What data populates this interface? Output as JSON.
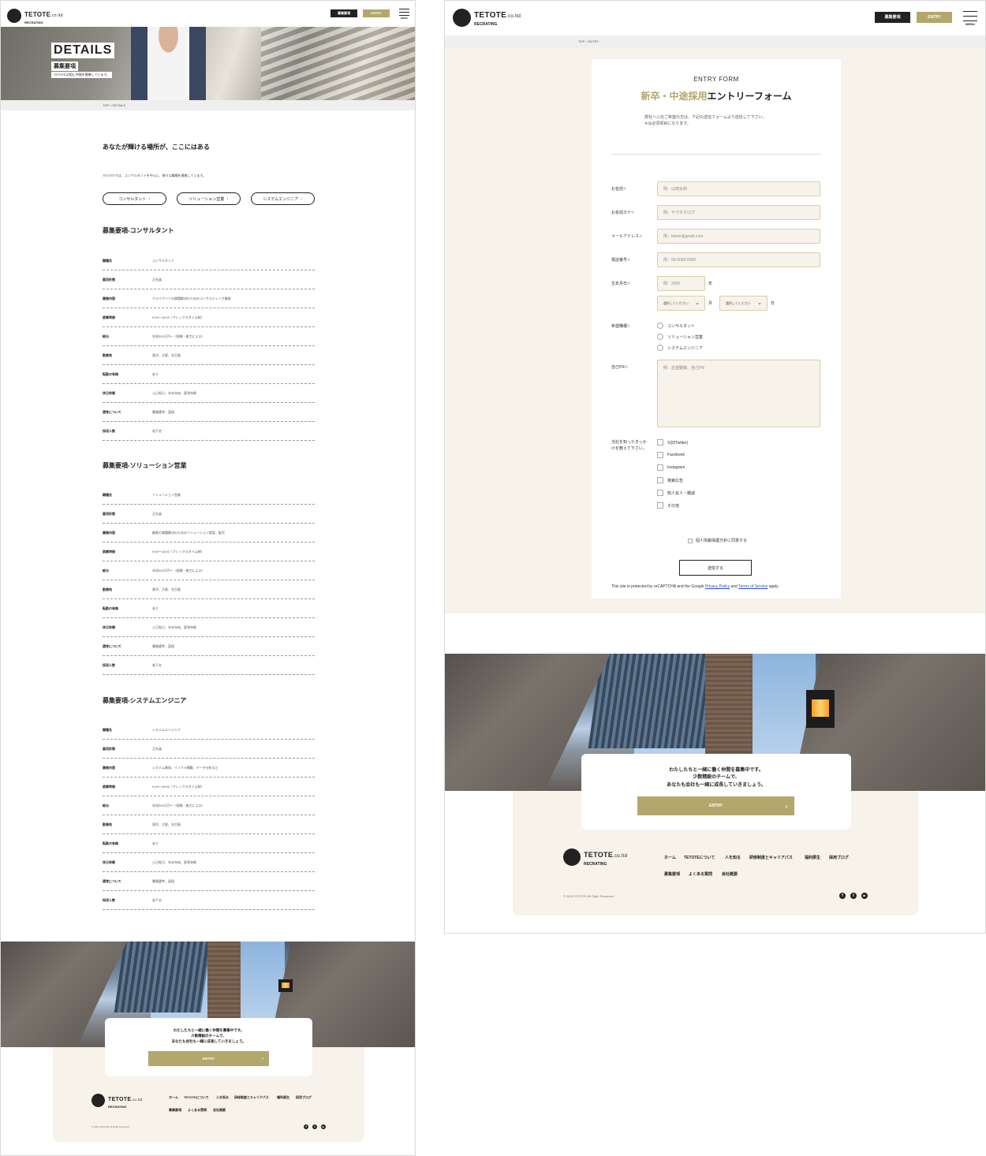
{
  "brand": {
    "name": "TETOTE",
    "suffix": ".co.ltd",
    "sub": "RECRATING"
  },
  "header": {
    "recruit_label": "募集要項",
    "entry_label": "ENTRY",
    "menu_label": "MENU"
  },
  "details": {
    "hero_title": "DETAILS",
    "hero_sub": "募集要項",
    "hero_tag": "TETOTEは組に仲間を募集しています。",
    "breadcrumb": "TOP > DETAILS",
    "lead": "あなたが輝ける場所が、ここにはある",
    "intro": "TETOTEでは、コンサルタントを中心に、様々な職種を募集しています。",
    "anchors": [
      {
        "label": "コンサルタント"
      },
      {
        "label": "ソリューション営業"
      },
      {
        "label": "システムエンジニア"
      }
    ],
    "sections": [
      {
        "title": "募集要項-コンサルタント",
        "rows": [
          {
            "k": "職種名",
            "v": "コンサルタント"
          },
          {
            "k": "雇用形態",
            "v": "正社員"
          },
          {
            "k": "業務内容",
            "v": "クライアントの課題解決のためのコンサルティング業務"
          },
          {
            "k": "就業時間",
            "v": "9:00〜18:00（フレックスタイム制）"
          },
          {
            "k": "給与",
            "v": "年収500万円〜（経験・能力による）"
          },
          {
            "k": "勤務地",
            "v": "東京、大阪、名古屋"
          },
          {
            "k": "転勤の有無",
            "v": "あり"
          },
          {
            "k": "休日休暇",
            "v": "土日祝日、年末年始、夏季休暇"
          },
          {
            "k": "選考について",
            "v": "書類選考、面接"
          },
          {
            "k": "採用人数",
            "v": "若干名"
          }
        ]
      },
      {
        "title": "募集要項-ソリューション営業",
        "rows": [
          {
            "k": "職種名",
            "v": "ソリューション営業"
          },
          {
            "k": "雇用形態",
            "v": "正社員"
          },
          {
            "k": "業務内容",
            "v": "顧客の課題解決のためのソリューション提案、販売"
          },
          {
            "k": "就業時間",
            "v": "9:00〜18:00（フレックスタイム制）"
          },
          {
            "k": "給与",
            "v": "年収500万円〜（経験・能力による）"
          },
          {
            "k": "勤務地",
            "v": "東京、大阪、名古屋"
          },
          {
            "k": "転勤の有無",
            "v": "あり"
          },
          {
            "k": "休日休暇",
            "v": "土日祝日、年末年始、夏季休暇"
          },
          {
            "k": "選考について",
            "v": "書類選考、面接"
          },
          {
            "k": "採用人数",
            "v": "若干名"
          }
        ]
      },
      {
        "title": "募集要項-システムエンジニア",
        "rows": [
          {
            "k": "職種名",
            "v": "システムエンジニア"
          },
          {
            "k": "雇用形態",
            "v": "正社員"
          },
          {
            "k": "業務内容",
            "v": "システム開発、インフラ構築、データ分析など"
          },
          {
            "k": "就業時間",
            "v": "9:00〜18:00（フレックスタイム制）"
          },
          {
            "k": "給与",
            "v": "年収500万円〜（経験・能力による）"
          },
          {
            "k": "勤務地",
            "v": "東京、大阪、名古屋"
          },
          {
            "k": "転勤の有無",
            "v": "あり"
          },
          {
            "k": "休日休暇",
            "v": "土日祝日、年末年始、夏季休暇"
          },
          {
            "k": "選考について",
            "v": "書類選考、面接"
          },
          {
            "k": "採用人数",
            "v": "若干名"
          }
        ]
      }
    ]
  },
  "cta": {
    "line1": "わたしたちと一緒に働く仲間を募集中です。",
    "line2": "少数精鋭のチームで、",
    "line3": "あなたも会社も一緒に成長していきましょう。",
    "button": "ENTRY"
  },
  "footer": {
    "nav_row1": [
      "ホーム",
      "TETOTEについて",
      "人を知る",
      "研修制度とキャリアパス",
      "福利厚生",
      "採用ブログ"
    ],
    "nav_row2": [
      "募集要項",
      "よくある質問",
      "会社概要"
    ],
    "copyright": "© 2024 TETOTE All Right Reserved.",
    "sns": [
      "f",
      "t",
      "▶"
    ]
  },
  "entry": {
    "breadcrumb": "TOP > ENTRY",
    "eyebrow": "ENTRY FORM",
    "title_gold": "新卒・中途採用",
    "title_rest": "エントリーフォーム",
    "note1": "弊社へ入社ご希望の方は、下記の送信フォームより送信して下さい。",
    "note2": "※は必須項目になります。",
    "required_mark": "※",
    "fields": {
      "name_label": "お名前",
      "name_ph": "例：山田太郎",
      "kana_label": "お名前カナ",
      "kana_ph": "例：ヤマダタロウ",
      "email_label": "メールアドレス",
      "email_ph": "例：tetote@gmail.com",
      "tel_label": "電話番号",
      "tel_ph": "例：00-0000-0000",
      "birth_label": "生年月日",
      "year_ph": "例：2000",
      "year_unit": "年",
      "month_select": "選択してください",
      "month_unit": "月",
      "day_select": "選択してください",
      "day_unit": "日",
      "job_label": "希望職種",
      "job_options": [
        "コンサルタント",
        "ソリューション営業",
        "システムエンジニア"
      ],
      "pr_label": "自己PR",
      "pr_ph": "例：志望動機、自己PR",
      "source_label": "当社を知ったきっかけを教えて下さい。",
      "source_options": [
        "X(旧Twitter)",
        "Facebook",
        "Instagram",
        "検索広告",
        "知人友人・親戚",
        "その他"
      ]
    },
    "agree": "個人情報保護方針に同意する",
    "submit": "送信する",
    "recaptcha_pre": "This site is protected by reCAPTCHA and the Google ",
    "recaptcha_privacy": "Privacy Policy",
    "recaptcha_and": " and ",
    "recaptcha_terms": "Terms of Service",
    "recaptcha_post": " apply."
  },
  "colors": {
    "gold": "#b3a76c",
    "dark": "#222222",
    "beige": "#f7f3ea"
  }
}
